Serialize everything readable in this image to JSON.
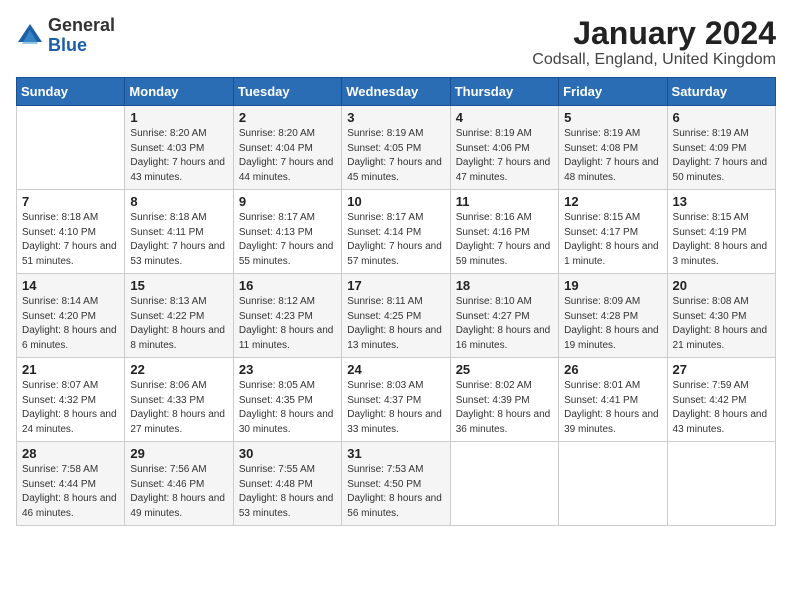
{
  "header": {
    "logo_general": "General",
    "logo_blue": "Blue",
    "month_title": "January 2024",
    "location": "Codsall, England, United Kingdom"
  },
  "days_of_week": [
    "Sunday",
    "Monday",
    "Tuesday",
    "Wednesday",
    "Thursday",
    "Friday",
    "Saturday"
  ],
  "weeks": [
    [
      {
        "day": "",
        "sunrise": "",
        "sunset": "",
        "daylight": ""
      },
      {
        "day": "1",
        "sunrise": "Sunrise: 8:20 AM",
        "sunset": "Sunset: 4:03 PM",
        "daylight": "Daylight: 7 hours and 43 minutes."
      },
      {
        "day": "2",
        "sunrise": "Sunrise: 8:20 AM",
        "sunset": "Sunset: 4:04 PM",
        "daylight": "Daylight: 7 hours and 44 minutes."
      },
      {
        "day": "3",
        "sunrise": "Sunrise: 8:19 AM",
        "sunset": "Sunset: 4:05 PM",
        "daylight": "Daylight: 7 hours and 45 minutes."
      },
      {
        "day": "4",
        "sunrise": "Sunrise: 8:19 AM",
        "sunset": "Sunset: 4:06 PM",
        "daylight": "Daylight: 7 hours and 47 minutes."
      },
      {
        "day": "5",
        "sunrise": "Sunrise: 8:19 AM",
        "sunset": "Sunset: 4:08 PM",
        "daylight": "Daylight: 7 hours and 48 minutes."
      },
      {
        "day": "6",
        "sunrise": "Sunrise: 8:19 AM",
        "sunset": "Sunset: 4:09 PM",
        "daylight": "Daylight: 7 hours and 50 minutes."
      }
    ],
    [
      {
        "day": "7",
        "sunrise": "Sunrise: 8:18 AM",
        "sunset": "Sunset: 4:10 PM",
        "daylight": "Daylight: 7 hours and 51 minutes."
      },
      {
        "day": "8",
        "sunrise": "Sunrise: 8:18 AM",
        "sunset": "Sunset: 4:11 PM",
        "daylight": "Daylight: 7 hours and 53 minutes."
      },
      {
        "day": "9",
        "sunrise": "Sunrise: 8:17 AM",
        "sunset": "Sunset: 4:13 PM",
        "daylight": "Daylight: 7 hours and 55 minutes."
      },
      {
        "day": "10",
        "sunrise": "Sunrise: 8:17 AM",
        "sunset": "Sunset: 4:14 PM",
        "daylight": "Daylight: 7 hours and 57 minutes."
      },
      {
        "day": "11",
        "sunrise": "Sunrise: 8:16 AM",
        "sunset": "Sunset: 4:16 PM",
        "daylight": "Daylight: 7 hours and 59 minutes."
      },
      {
        "day": "12",
        "sunrise": "Sunrise: 8:15 AM",
        "sunset": "Sunset: 4:17 PM",
        "daylight": "Daylight: 8 hours and 1 minute."
      },
      {
        "day": "13",
        "sunrise": "Sunrise: 8:15 AM",
        "sunset": "Sunset: 4:19 PM",
        "daylight": "Daylight: 8 hours and 3 minutes."
      }
    ],
    [
      {
        "day": "14",
        "sunrise": "Sunrise: 8:14 AM",
        "sunset": "Sunset: 4:20 PM",
        "daylight": "Daylight: 8 hours and 6 minutes."
      },
      {
        "day": "15",
        "sunrise": "Sunrise: 8:13 AM",
        "sunset": "Sunset: 4:22 PM",
        "daylight": "Daylight: 8 hours and 8 minutes."
      },
      {
        "day": "16",
        "sunrise": "Sunrise: 8:12 AM",
        "sunset": "Sunset: 4:23 PM",
        "daylight": "Daylight: 8 hours and 11 minutes."
      },
      {
        "day": "17",
        "sunrise": "Sunrise: 8:11 AM",
        "sunset": "Sunset: 4:25 PM",
        "daylight": "Daylight: 8 hours and 13 minutes."
      },
      {
        "day": "18",
        "sunrise": "Sunrise: 8:10 AM",
        "sunset": "Sunset: 4:27 PM",
        "daylight": "Daylight: 8 hours and 16 minutes."
      },
      {
        "day": "19",
        "sunrise": "Sunrise: 8:09 AM",
        "sunset": "Sunset: 4:28 PM",
        "daylight": "Daylight: 8 hours and 19 minutes."
      },
      {
        "day": "20",
        "sunrise": "Sunrise: 8:08 AM",
        "sunset": "Sunset: 4:30 PM",
        "daylight": "Daylight: 8 hours and 21 minutes."
      }
    ],
    [
      {
        "day": "21",
        "sunrise": "Sunrise: 8:07 AM",
        "sunset": "Sunset: 4:32 PM",
        "daylight": "Daylight: 8 hours and 24 minutes."
      },
      {
        "day": "22",
        "sunrise": "Sunrise: 8:06 AM",
        "sunset": "Sunset: 4:33 PM",
        "daylight": "Daylight: 8 hours and 27 minutes."
      },
      {
        "day": "23",
        "sunrise": "Sunrise: 8:05 AM",
        "sunset": "Sunset: 4:35 PM",
        "daylight": "Daylight: 8 hours and 30 minutes."
      },
      {
        "day": "24",
        "sunrise": "Sunrise: 8:03 AM",
        "sunset": "Sunset: 4:37 PM",
        "daylight": "Daylight: 8 hours and 33 minutes."
      },
      {
        "day": "25",
        "sunrise": "Sunrise: 8:02 AM",
        "sunset": "Sunset: 4:39 PM",
        "daylight": "Daylight: 8 hours and 36 minutes."
      },
      {
        "day": "26",
        "sunrise": "Sunrise: 8:01 AM",
        "sunset": "Sunset: 4:41 PM",
        "daylight": "Daylight: 8 hours and 39 minutes."
      },
      {
        "day": "27",
        "sunrise": "Sunrise: 7:59 AM",
        "sunset": "Sunset: 4:42 PM",
        "daylight": "Daylight: 8 hours and 43 minutes."
      }
    ],
    [
      {
        "day": "28",
        "sunrise": "Sunrise: 7:58 AM",
        "sunset": "Sunset: 4:44 PM",
        "daylight": "Daylight: 8 hours and 46 minutes."
      },
      {
        "day": "29",
        "sunrise": "Sunrise: 7:56 AM",
        "sunset": "Sunset: 4:46 PM",
        "daylight": "Daylight: 8 hours and 49 minutes."
      },
      {
        "day": "30",
        "sunrise": "Sunrise: 7:55 AM",
        "sunset": "Sunset: 4:48 PM",
        "daylight": "Daylight: 8 hours and 53 minutes."
      },
      {
        "day": "31",
        "sunrise": "Sunrise: 7:53 AM",
        "sunset": "Sunset: 4:50 PM",
        "daylight": "Daylight: 8 hours and 56 minutes."
      },
      {
        "day": "",
        "sunrise": "",
        "sunset": "",
        "daylight": ""
      },
      {
        "day": "",
        "sunrise": "",
        "sunset": "",
        "daylight": ""
      },
      {
        "day": "",
        "sunrise": "",
        "sunset": "",
        "daylight": ""
      }
    ]
  ]
}
